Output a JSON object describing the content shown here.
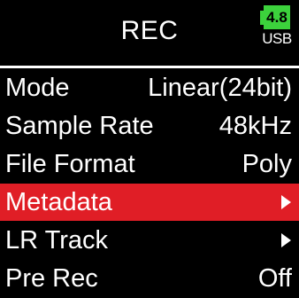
{
  "header": {
    "title": "REC",
    "battery": {
      "level": "4.8",
      "source": "USB",
      "color": "#3cd23c"
    }
  },
  "menu": {
    "selected_color": "#e01e26",
    "items": [
      {
        "label": "Mode",
        "value": "Linear(24bit)"
      },
      {
        "label": "Sample Rate",
        "value": "48kHz"
      },
      {
        "label": "File Format",
        "value": "Poly"
      },
      {
        "label": "Metadata",
        "value": "",
        "icon": "arrow-right-icon",
        "selected": true
      },
      {
        "label": "LR Track",
        "value": "",
        "icon": "arrow-right-icon"
      },
      {
        "label": "Pre Rec",
        "value": "Off"
      }
    ]
  }
}
